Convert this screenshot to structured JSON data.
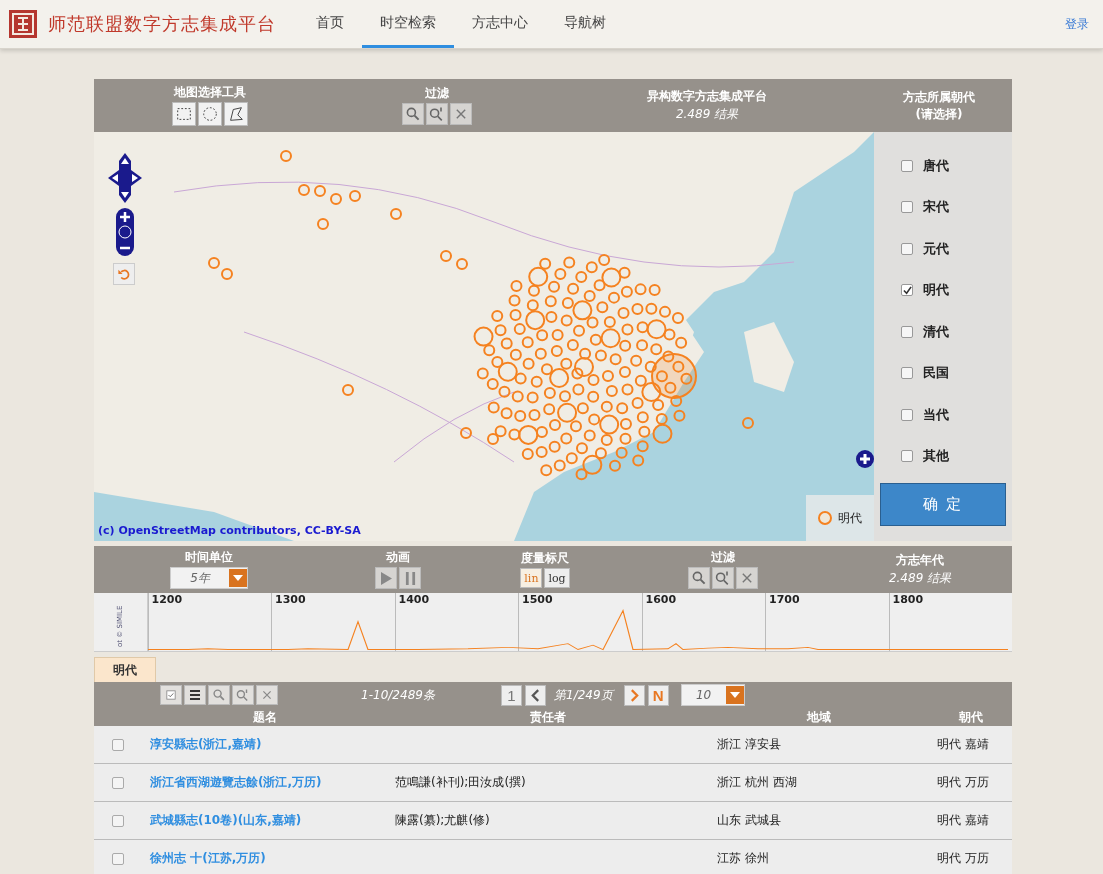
{
  "app": {
    "title": "师范联盟数字方志集成平台",
    "login": "登录"
  },
  "nav": [
    {
      "label": "首页",
      "selected": false
    },
    {
      "label": "时空检索",
      "selected": true
    },
    {
      "label": "方志中心",
      "selected": false
    },
    {
      "label": "导航树",
      "selected": false
    }
  ],
  "map_toolbar": {
    "select_tools_label": "地图选择工具",
    "filter_label": "过滤",
    "platform_title": "异构数字方志集成平台",
    "results": "2.489 结果",
    "dynasty_title": "方志所属朝代",
    "dynasty_hint": "(请选择)"
  },
  "dynasties": [
    {
      "label": "唐代",
      "checked": false
    },
    {
      "label": "宋代",
      "checked": false
    },
    {
      "label": "元代",
      "checked": false
    },
    {
      "label": "明代",
      "checked": true
    },
    {
      "label": "清代",
      "checked": false
    },
    {
      "label": "民国",
      "checked": false
    },
    {
      "label": "当代",
      "checked": false
    },
    {
      "label": "其他",
      "checked": false
    }
  ],
  "confirm_button": "确 定",
  "map": {
    "attribution": "(c) OpenStreetMap contributors, CC-BY-SA",
    "legend": "明代"
  },
  "timeline_toolbar": {
    "time_unit_label": "时间单位",
    "time_unit_value": "5年",
    "animation_label": "动画",
    "scale_label": "度量标尺",
    "scale_options": [
      {
        "label": "lin",
        "selected": true
      },
      {
        "label": "log",
        "selected": false
      }
    ],
    "filter_label": "过滤",
    "era_label": "方志年代",
    "results": "2.489 结果"
  },
  "timeline": {
    "credit": "ot © SIMILE",
    "ticks": [
      "1200",
      "1300",
      "1400",
      "1500",
      "1600",
      "1700",
      "1800"
    ]
  },
  "result_tabs": [
    {
      "label": "明代",
      "selected": true
    }
  ],
  "table_toolbar": {
    "range": "1-10/2489条",
    "first_page": "1",
    "page": "第1/249页",
    "last_page": "N",
    "page_size": "10"
  },
  "table": {
    "columns": [
      "题名",
      "责任者",
      "地域",
      "朝代"
    ],
    "rows": [
      {
        "checked": false,
        "title": "淳安縣志(浙江,嘉靖)",
        "author": "",
        "region": "浙江 淳安县",
        "dynasty": "明代 嘉靖"
      },
      {
        "checked": false,
        "title": "浙江省西湖遊覽志餘(浙江,万历)",
        "author": "范鳴謙(补刊);田汝成(撰)",
        "region": "浙江 杭州 西湖",
        "dynasty": "明代 万历"
      },
      {
        "checked": false,
        "title": "武城縣志(10卷)(山东,嘉靖)",
        "author": "陳露(纂);尤麒(修)",
        "region": "山东 武城县",
        "dynasty": "明代 嘉靖"
      },
      {
        "checked": false,
        "title": "徐州志 十(江苏,万历)",
        "author": "",
        "region": "江苏 徐州",
        "dynasty": "明代 万历"
      }
    ]
  }
}
